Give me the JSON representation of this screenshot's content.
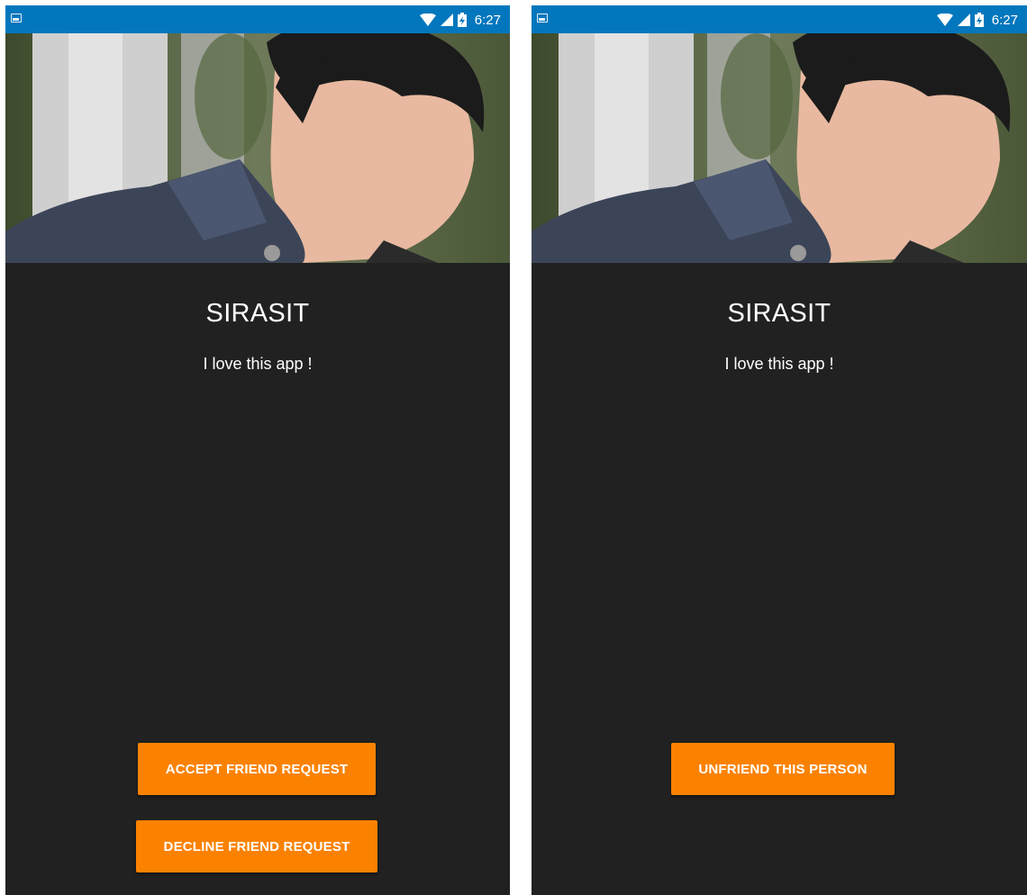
{
  "screens": [
    {
      "status_bar": {
        "time": "6:27"
      },
      "profile": {
        "name": "SIRASIT",
        "status_message": "I love this app !"
      },
      "buttons": {
        "accept": "ACCEPT FRIEND REQUEST",
        "decline": "DECLINE FRIEND REQUEST"
      }
    },
    {
      "status_bar": {
        "time": "6:27"
      },
      "profile": {
        "name": "SIRASIT",
        "status_message": "I love this app !"
      },
      "buttons": {
        "unfriend": "UNFRIEND THIS PERSON"
      }
    }
  ],
  "colors": {
    "status_bar": "#0277bd",
    "background": "#212121",
    "button": "#fb8200",
    "text": "#ffffff"
  },
  "icons": [
    "image-notification-icon",
    "wifi-icon",
    "cell-signal-icon",
    "battery-charging-icon"
  ]
}
